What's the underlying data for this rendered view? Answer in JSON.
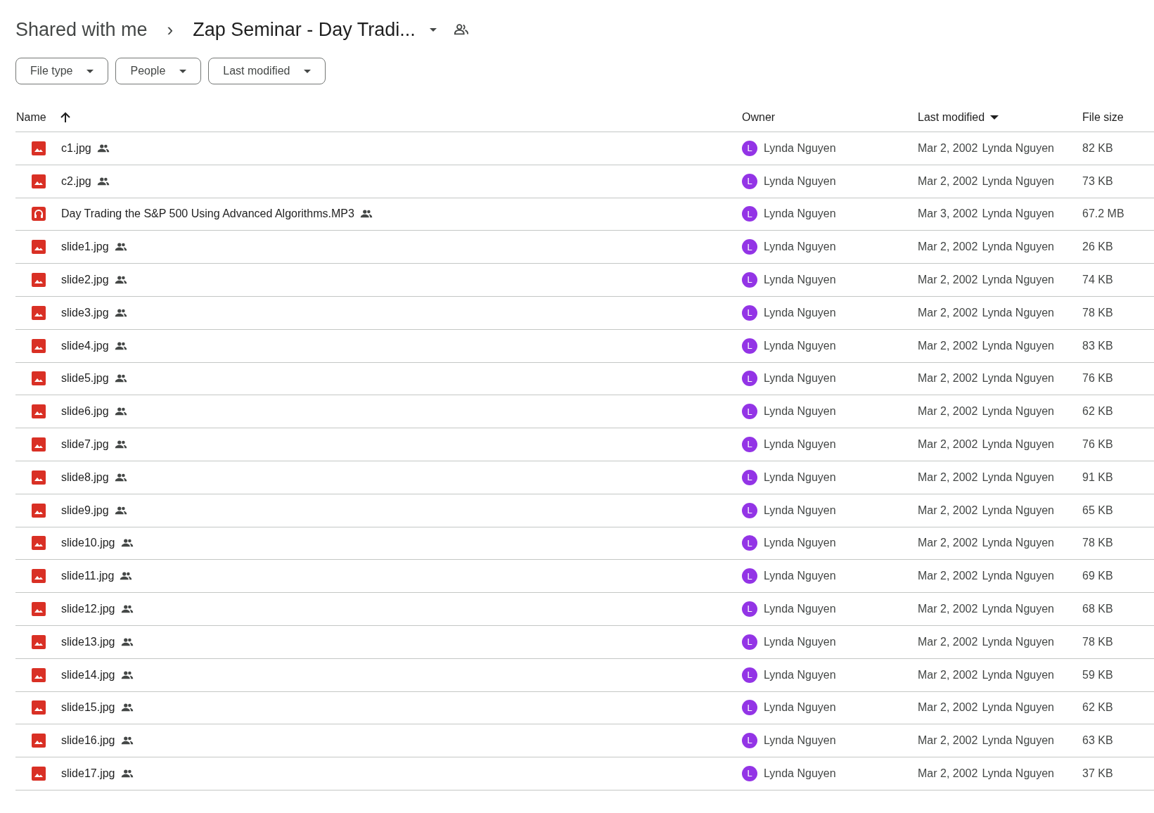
{
  "breadcrumb": {
    "parent": "Shared with me",
    "separator": "›",
    "current": "Zap Seminar - Day Tradi..."
  },
  "filters": [
    {
      "label": "File type"
    },
    {
      "label": "People"
    },
    {
      "label": "Last modified"
    }
  ],
  "table": {
    "columns": [
      {
        "label": "Name",
        "sorted_ascending": true,
        "sorted_descending": false
      },
      {
        "label": "Owner",
        "sorted_ascending": false,
        "sorted_descending": false
      },
      {
        "label": "Last modified",
        "sorted_ascending": false,
        "sorted_descending": true
      },
      {
        "label": "File size",
        "sorted_ascending": false,
        "sorted_descending": false
      }
    ],
    "rows": [
      {
        "kind": "image",
        "name": "c1.jpg",
        "owner_initial": "L",
        "owner": "Lynda Nguyen",
        "date": "Mar 2, 2002",
        "modified_by": "Lynda Nguyen",
        "size": "82 KB"
      },
      {
        "kind": "image",
        "name": "c2.jpg",
        "owner_initial": "L",
        "owner": "Lynda Nguyen",
        "date": "Mar 2, 2002",
        "modified_by": "Lynda Nguyen",
        "size": "73 KB"
      },
      {
        "kind": "audio",
        "name": "Day Trading the S&P 500 Using Advanced Algorithms.MP3",
        "owner_initial": "L",
        "owner": "Lynda Nguyen",
        "date": "Mar 3, 2002",
        "modified_by": "Lynda Nguyen",
        "size": "67.2 MB"
      },
      {
        "kind": "image",
        "name": "slide1.jpg",
        "owner_initial": "L",
        "owner": "Lynda Nguyen",
        "date": "Mar 2, 2002",
        "modified_by": "Lynda Nguyen",
        "size": "26 KB"
      },
      {
        "kind": "image",
        "name": "slide2.jpg",
        "owner_initial": "L",
        "owner": "Lynda Nguyen",
        "date": "Mar 2, 2002",
        "modified_by": "Lynda Nguyen",
        "size": "74 KB"
      },
      {
        "kind": "image",
        "name": "slide3.jpg",
        "owner_initial": "L",
        "owner": "Lynda Nguyen",
        "date": "Mar 2, 2002",
        "modified_by": "Lynda Nguyen",
        "size": "78 KB"
      },
      {
        "kind": "image",
        "name": "slide4.jpg",
        "owner_initial": "L",
        "owner": "Lynda Nguyen",
        "date": "Mar 2, 2002",
        "modified_by": "Lynda Nguyen",
        "size": "83 KB"
      },
      {
        "kind": "image",
        "name": "slide5.jpg",
        "owner_initial": "L",
        "owner": "Lynda Nguyen",
        "date": "Mar 2, 2002",
        "modified_by": "Lynda Nguyen",
        "size": "76 KB"
      },
      {
        "kind": "image",
        "name": "slide6.jpg",
        "owner_initial": "L",
        "owner": "Lynda Nguyen",
        "date": "Mar 2, 2002",
        "modified_by": "Lynda Nguyen",
        "size": "62 KB"
      },
      {
        "kind": "image",
        "name": "slide7.jpg",
        "owner_initial": "L",
        "owner": "Lynda Nguyen",
        "date": "Mar 2, 2002",
        "modified_by": "Lynda Nguyen",
        "size": "76 KB"
      },
      {
        "kind": "image",
        "name": "slide8.jpg",
        "owner_initial": "L",
        "owner": "Lynda Nguyen",
        "date": "Mar 2, 2002",
        "modified_by": "Lynda Nguyen",
        "size": "91 KB"
      },
      {
        "kind": "image",
        "name": "slide9.jpg",
        "owner_initial": "L",
        "owner": "Lynda Nguyen",
        "date": "Mar 2, 2002",
        "modified_by": "Lynda Nguyen",
        "size": "65 KB"
      },
      {
        "kind": "image",
        "name": "slide10.jpg",
        "owner_initial": "L",
        "owner": "Lynda Nguyen",
        "date": "Mar 2, 2002",
        "modified_by": "Lynda Nguyen",
        "size": "78 KB"
      },
      {
        "kind": "image",
        "name": "slide11.jpg",
        "owner_initial": "L",
        "owner": "Lynda Nguyen",
        "date": "Mar 2, 2002",
        "modified_by": "Lynda Nguyen",
        "size": "69 KB"
      },
      {
        "kind": "image",
        "name": "slide12.jpg",
        "owner_initial": "L",
        "owner": "Lynda Nguyen",
        "date": "Mar 2, 2002",
        "modified_by": "Lynda Nguyen",
        "size": "68 KB"
      },
      {
        "kind": "image",
        "name": "slide13.jpg",
        "owner_initial": "L",
        "owner": "Lynda Nguyen",
        "date": "Mar 2, 2002",
        "modified_by": "Lynda Nguyen",
        "size": "78 KB"
      },
      {
        "kind": "image",
        "name": "slide14.jpg",
        "owner_initial": "L",
        "owner": "Lynda Nguyen",
        "date": "Mar 2, 2002",
        "modified_by": "Lynda Nguyen",
        "size": "59 KB"
      },
      {
        "kind": "image",
        "name": "slide15.jpg",
        "owner_initial": "L",
        "owner": "Lynda Nguyen",
        "date": "Mar 2, 2002",
        "modified_by": "Lynda Nguyen",
        "size": "62 KB"
      },
      {
        "kind": "image",
        "name": "slide16.jpg",
        "owner_initial": "L",
        "owner": "Lynda Nguyen",
        "date": "Mar 2, 2002",
        "modified_by": "Lynda Nguyen",
        "size": "63 KB"
      },
      {
        "kind": "image",
        "name": "slide17.jpg",
        "owner_initial": "L",
        "owner": "Lynda Nguyen",
        "date": "Mar 2, 2002",
        "modified_by": "Lynda Nguyen",
        "size": "37 KB"
      }
    ]
  }
}
